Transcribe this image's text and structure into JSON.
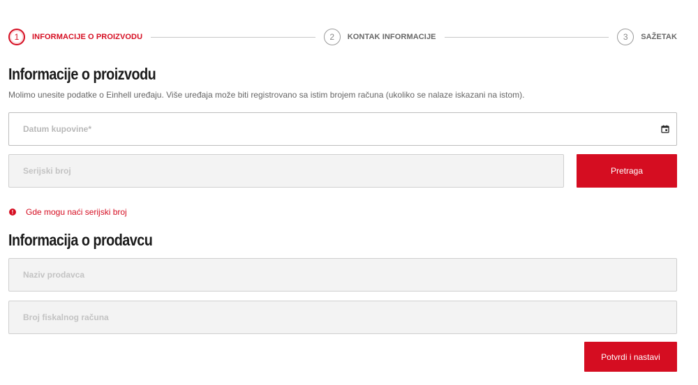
{
  "stepper": {
    "steps": [
      {
        "number": "1",
        "label": "INFORMACIJE O PROIZVODU",
        "active": true
      },
      {
        "number": "2",
        "label": "KONTAK INFORMACIJE",
        "active": false
      },
      {
        "number": "3",
        "label": "SAŽETAK",
        "active": false
      }
    ]
  },
  "product_section": {
    "title": "Informacije o proizvodu",
    "description": "Molimo unesite podatke o Einhell uređaju. Više uređaja može biti registrovano sa istim brojem računa (ukoliko se nalaze iskazani na istom).",
    "date_field": {
      "placeholder": "Datum kupovine*",
      "icon": "calendar-icon"
    },
    "serial_field": {
      "placeholder": "Serijski broj"
    },
    "search_button": "Pretraga",
    "help_link": {
      "icon": "info-icon",
      "label": "Gde mogu naći serijski broj"
    }
  },
  "seller_section": {
    "title": "Informacija o prodavcu",
    "seller_field": {
      "placeholder": "Naziv prodavca"
    },
    "receipt_field": {
      "placeholder": "Broj fiskalnog računa"
    }
  },
  "confirm_button": "Potvrdi i nastavi",
  "colors": {
    "accent": "#d50d21",
    "field_bg": "#f3f3f3",
    "border": "#cfcfcf"
  }
}
